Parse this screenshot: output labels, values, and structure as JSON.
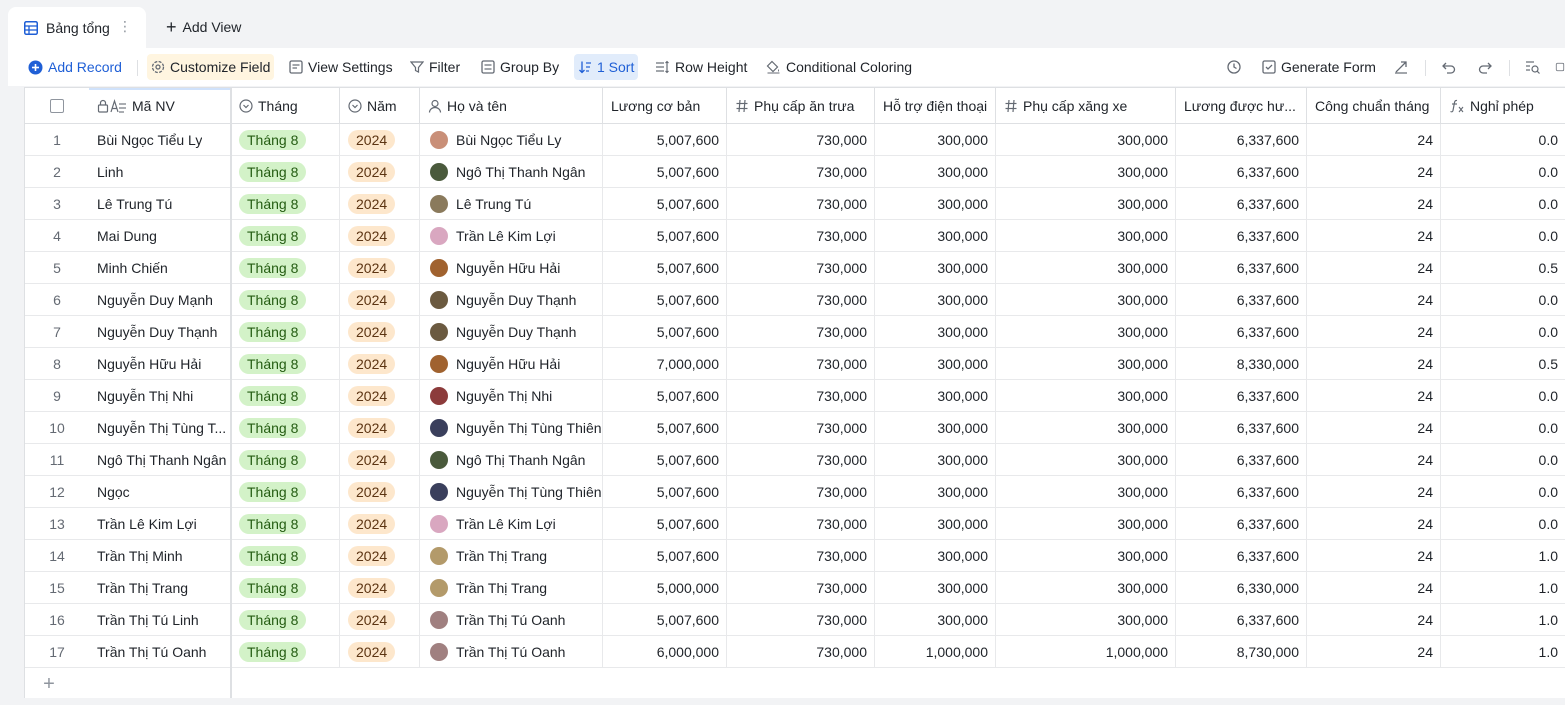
{
  "tab": {
    "label": "Bảng tổng",
    "more": "⋮"
  },
  "add_view": {
    "label": "Add View"
  },
  "toolbar": {
    "add_record": "Add Record",
    "customize_field": "Customize Field",
    "view_settings": "View Settings",
    "filter": "Filter",
    "group_by": "Group By",
    "sort": "1 Sort",
    "row_height": "Row Height",
    "conditional_coloring": "Conditional Coloring",
    "generate_form": "Generate Form",
    "accent": "#1f5fd6"
  },
  "columns": [
    {
      "key": "ma_nv",
      "label": "Mã NV",
      "icon": "lock-text-icon"
    },
    {
      "key": "thang",
      "label": "Tháng",
      "icon": "single-select-icon"
    },
    {
      "key": "nam",
      "label": "Năm",
      "icon": "single-select-icon"
    },
    {
      "key": "ho_ten",
      "label": "Họ và tên",
      "icon": "person-icon"
    },
    {
      "key": "luong_co_ban",
      "label": "Lương cơ bản",
      "icon": ""
    },
    {
      "key": "phu_cap_an",
      "label": "Phụ cấp ăn trưa",
      "icon": "number-icon"
    },
    {
      "key": "ho_tro_dt",
      "label": "Hỗ trợ điện thoại",
      "icon": ""
    },
    {
      "key": "phu_cap_xang",
      "label": "Phụ cấp xăng xe",
      "icon": "number-icon"
    },
    {
      "key": "luong_duoc_huong",
      "label": "Lương được hư...",
      "icon": ""
    },
    {
      "key": "cong_chuan",
      "label": "Công chuẩn tháng",
      "icon": ""
    },
    {
      "key": "nghi_phep",
      "label": "Nghỉ phép",
      "icon": "formula-icon"
    }
  ],
  "rows": [
    {
      "idx": "1",
      "ma_nv": "Bùi Ngọc Tiểu Ly",
      "thang": "Tháng 8",
      "nam": "2024",
      "ho_ten": "Bùi Ngọc Tiểu Ly",
      "avatar_color": "#c98f78",
      "luong_co_ban": "5,007,600",
      "phu_cap_an": "730,000",
      "ho_tro_dt": "300,000",
      "phu_cap_xang": "300,000",
      "luong_duoc_huong": "6,337,600",
      "cong_chuan": "24",
      "nghi_phep": "0.0"
    },
    {
      "idx": "2",
      "ma_nv": "Linh",
      "thang": "Tháng 8",
      "nam": "2024",
      "ho_ten": "Ngô Thị Thanh Ngân",
      "avatar_color": "#4a5a3c",
      "luong_co_ban": "5,007,600",
      "phu_cap_an": "730,000",
      "ho_tro_dt": "300,000",
      "phu_cap_xang": "300,000",
      "luong_duoc_huong": "6,337,600",
      "cong_chuan": "24",
      "nghi_phep": "0.0"
    },
    {
      "idx": "3",
      "ma_nv": "Lê Trung Tú",
      "thang": "Tháng 8",
      "nam": "2024",
      "ho_ten": "Lê Trung Tú",
      "avatar_color": "#8a7a5c",
      "luong_co_ban": "5,007,600",
      "phu_cap_an": "730,000",
      "ho_tro_dt": "300,000",
      "phu_cap_xang": "300,000",
      "luong_duoc_huong": "6,337,600",
      "cong_chuan": "24",
      "nghi_phep": "0.0"
    },
    {
      "idx": "4",
      "ma_nv": "Mai Dung",
      "thang": "Tháng 8",
      "nam": "2024",
      "ho_ten": "Trần Lê Kim Lợi",
      "avatar_color": "#d9a7c0",
      "luong_co_ban": "5,007,600",
      "phu_cap_an": "730,000",
      "ho_tro_dt": "300,000",
      "phu_cap_xang": "300,000",
      "luong_duoc_huong": "6,337,600",
      "cong_chuan": "24",
      "nghi_phep": "0.0"
    },
    {
      "idx": "5",
      "ma_nv": "Minh Chiến",
      "thang": "Tháng 8",
      "nam": "2024",
      "ho_ten": "Nguyễn Hữu Hải",
      "avatar_color": "#a0622f",
      "luong_co_ban": "5,007,600",
      "phu_cap_an": "730,000",
      "ho_tro_dt": "300,000",
      "phu_cap_xang": "300,000",
      "luong_duoc_huong": "6,337,600",
      "cong_chuan": "24",
      "nghi_phep": "0.5"
    },
    {
      "idx": "6",
      "ma_nv": "Nguyễn Duy Mạnh",
      "thang": "Tháng 8",
      "nam": "2024",
      "ho_ten": "Nguyễn Duy Thạnh",
      "avatar_color": "#6b5a40",
      "luong_co_ban": "5,007,600",
      "phu_cap_an": "730,000",
      "ho_tro_dt": "300,000",
      "phu_cap_xang": "300,000",
      "luong_duoc_huong": "6,337,600",
      "cong_chuan": "24",
      "nghi_phep": "0.0"
    },
    {
      "idx": "7",
      "ma_nv": "Nguyễn Duy Thạnh",
      "thang": "Tháng 8",
      "nam": "2024",
      "ho_ten": "Nguyễn Duy Thạnh",
      "avatar_color": "#6b5a40",
      "luong_co_ban": "5,007,600",
      "phu_cap_an": "730,000",
      "ho_tro_dt": "300,000",
      "phu_cap_xang": "300,000",
      "luong_duoc_huong": "6,337,600",
      "cong_chuan": "24",
      "nghi_phep": "0.0"
    },
    {
      "idx": "8",
      "ma_nv": "Nguyễn Hữu Hải",
      "thang": "Tháng 8",
      "nam": "2024",
      "ho_ten": "Nguyễn Hữu Hải",
      "avatar_color": "#a0622f",
      "luong_co_ban": "7,000,000",
      "phu_cap_an": "730,000",
      "ho_tro_dt": "300,000",
      "phu_cap_xang": "300,000",
      "luong_duoc_huong": "8,330,000",
      "cong_chuan": "24",
      "nghi_phep": "0.5"
    },
    {
      "idx": "9",
      "ma_nv": "Nguyễn Thị Nhi",
      "thang": "Tháng 8",
      "nam": "2024",
      "ho_ten": "Nguyễn Thị  Nhi",
      "avatar_color": "#8c3b3b",
      "luong_co_ban": "5,007,600",
      "phu_cap_an": "730,000",
      "ho_tro_dt": "300,000",
      "phu_cap_xang": "300,000",
      "luong_duoc_huong": "6,337,600",
      "cong_chuan": "24",
      "nghi_phep": "0.0"
    },
    {
      "idx": "10",
      "ma_nv": "Nguyễn Thị Tùng T...",
      "thang": "Tháng 8",
      "nam": "2024",
      "ho_ten": "Nguyễn Thị Tùng Thiên",
      "avatar_color": "#3a3f5c",
      "luong_co_ban": "5,007,600",
      "phu_cap_an": "730,000",
      "ho_tro_dt": "300,000",
      "phu_cap_xang": "300,000",
      "luong_duoc_huong": "6,337,600",
      "cong_chuan": "24",
      "nghi_phep": "0.0"
    },
    {
      "idx": "11",
      "ma_nv": "Ngô Thị Thanh Ngân",
      "thang": "Tháng 8",
      "nam": "2024",
      "ho_ten": "Ngô Thị Thanh Ngân",
      "avatar_color": "#4a5a3c",
      "luong_co_ban": "5,007,600",
      "phu_cap_an": "730,000",
      "ho_tro_dt": "300,000",
      "phu_cap_xang": "300,000",
      "luong_duoc_huong": "6,337,600",
      "cong_chuan": "24",
      "nghi_phep": "0.0"
    },
    {
      "idx": "12",
      "ma_nv": "Ngọc",
      "thang": "Tháng 8",
      "nam": "2024",
      "ho_ten": "Nguyễn Thị Tùng Thiên",
      "avatar_color": "#3a3f5c",
      "luong_co_ban": "5,007,600",
      "phu_cap_an": "730,000",
      "ho_tro_dt": "300,000",
      "phu_cap_xang": "300,000",
      "luong_duoc_huong": "6,337,600",
      "cong_chuan": "24",
      "nghi_phep": "0.0"
    },
    {
      "idx": "13",
      "ma_nv": "Trần Lê Kim Lợi",
      "thang": "Tháng 8",
      "nam": "2024",
      "ho_ten": "Trần Lê Kim Lợi",
      "avatar_color": "#d9a7c0",
      "luong_co_ban": "5,007,600",
      "phu_cap_an": "730,000",
      "ho_tro_dt": "300,000",
      "phu_cap_xang": "300,000",
      "luong_duoc_huong": "6,337,600",
      "cong_chuan": "24",
      "nghi_phep": "0.0"
    },
    {
      "idx": "14",
      "ma_nv": "Trần Thị Minh",
      "thang": "Tháng 8",
      "nam": "2024",
      "ho_ten": "Trần Thị Trang",
      "avatar_color": "#b39a6a",
      "luong_co_ban": "5,007,600",
      "phu_cap_an": "730,000",
      "ho_tro_dt": "300,000",
      "phu_cap_xang": "300,000",
      "luong_duoc_huong": "6,337,600",
      "cong_chuan": "24",
      "nghi_phep": "1.0"
    },
    {
      "idx": "15",
      "ma_nv": "Trần Thị Trang",
      "thang": "Tháng 8",
      "nam": "2024",
      "ho_ten": "Trần Thị Trang",
      "avatar_color": "#b39a6a",
      "luong_co_ban": "5,000,000",
      "phu_cap_an": "730,000",
      "ho_tro_dt": "300,000",
      "phu_cap_xang": "300,000",
      "luong_duoc_huong": "6,330,000",
      "cong_chuan": "24",
      "nghi_phep": "1.0"
    },
    {
      "idx": "16",
      "ma_nv": "Trần Thị Tú Linh",
      "thang": "Tháng 8",
      "nam": "2024",
      "ho_ten": "Trần Thị Tú Oanh",
      "avatar_color": "#a08080",
      "luong_co_ban": "5,007,600",
      "phu_cap_an": "730,000",
      "ho_tro_dt": "300,000",
      "phu_cap_xang": "300,000",
      "luong_duoc_huong": "6,337,600",
      "cong_chuan": "24",
      "nghi_phep": "1.0"
    },
    {
      "idx": "17",
      "ma_nv": "Trần Thị Tú Oanh",
      "thang": "Tháng 8",
      "nam": "2024",
      "ho_ten": "Trần Thị Tú Oanh",
      "avatar_color": "#a08080",
      "luong_co_ban": "6,000,000",
      "phu_cap_an": "730,000",
      "ho_tro_dt": "1,000,000",
      "phu_cap_xang": "1,000,000",
      "luong_duoc_huong": "8,730,000",
      "cong_chuan": "24",
      "nghi_phep": "1.0"
    }
  ],
  "add_row": {
    "symbol": "+"
  }
}
